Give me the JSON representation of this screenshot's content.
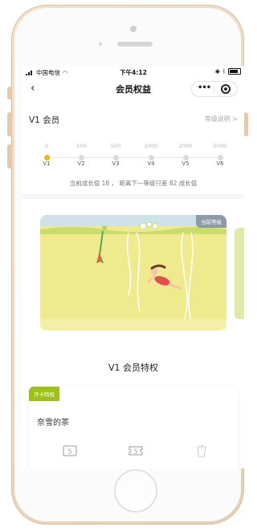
{
  "status_bar": {
    "carrier": "中国电信",
    "time": "下午4:12"
  },
  "nav": {
    "back_icon": "chevron-left-icon",
    "title": "会员权益",
    "more_icon": "more-dots-icon",
    "close_icon": "record-circle-icon"
  },
  "member": {
    "title": "V1 会员",
    "level_link": "等级说明 >"
  },
  "levels": [
    {
      "threshold": "0",
      "name": "V1",
      "active": true
    },
    {
      "threshold": "100",
      "name": "V2",
      "active": false
    },
    {
      "threshold": "500",
      "name": "V3",
      "active": false
    },
    {
      "threshold": "1000",
      "name": "V4",
      "active": false
    },
    {
      "threshold": "2000",
      "name": "V5",
      "active": false
    },
    {
      "threshold": "5000",
      "name": "V6",
      "active": false
    }
  ],
  "growth_text": "当前成长值 18 ， 距离下一等级只差 82 成长值",
  "card": {
    "tag": "当前等级"
  },
  "privileges_title": "V1 会员特权",
  "open_card": {
    "badge": "开卡特权",
    "brand": "奈雪的茶",
    "icons": [
      "coupon-5-icon",
      "voucher-5-icon",
      "cup-icon"
    ]
  },
  "colors": {
    "accent_yellow": "#f1b700",
    "badge_green": "#9cc21a",
    "card_bg": "#f2ec93"
  }
}
